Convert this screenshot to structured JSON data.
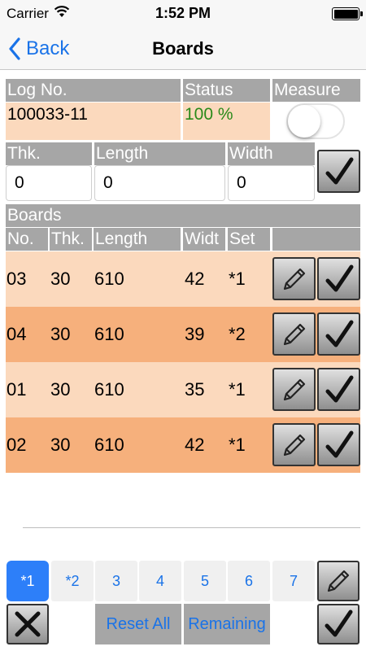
{
  "status_bar": {
    "carrier": "Carrier",
    "time": "1:52 PM"
  },
  "nav": {
    "back_label": "Back",
    "title": "Boards"
  },
  "log": {
    "log_no_label": "Log No.",
    "status_label": "Status",
    "measure_label": "Measure",
    "log_no_value": "100033-11",
    "status_value": "100 %",
    "status_color": "#2a8a1a",
    "measure_on": false
  },
  "entry": {
    "thk_label": "Thk.",
    "length_label": "Length",
    "width_label": "Width",
    "thk_value": "0",
    "length_value": "0",
    "width_value": "0"
  },
  "boards": {
    "title": "Boards",
    "columns": [
      "No.",
      "Thk.",
      "Length",
      "Widt",
      "Set"
    ],
    "rows": [
      {
        "no": "03",
        "thk": "30",
        "length": "610",
        "width": "42",
        "set": "*1"
      },
      {
        "no": "04",
        "thk": "30",
        "length": "610",
        "width": "39",
        "set": "*2"
      },
      {
        "no": "01",
        "thk": "30",
        "length": "610",
        "width": "35",
        "set": "*1"
      },
      {
        "no": "02",
        "thk": "30",
        "length": "610",
        "width": "42",
        "set": "*1"
      }
    ]
  },
  "sets": {
    "buttons": [
      "*1",
      "*2",
      "3",
      "4",
      "5",
      "6",
      "7"
    ],
    "active_index": 0
  },
  "bottom": {
    "reset_all_label": "Reset All",
    "remaining_label": "Remaining"
  },
  "colors": {
    "accent": "#1a73e8",
    "header_gray": "#a6a6a6",
    "row_light": "#fbd9bd",
    "row_dark": "#f6b07c",
    "active_set": "#2d7ff9"
  },
  "icons": {
    "edit": "pencil-icon",
    "confirm": "checkmark-icon",
    "cancel": "x-icon",
    "back": "chevron-left-icon",
    "wifi": "wifi-icon",
    "battery": "battery-icon"
  }
}
